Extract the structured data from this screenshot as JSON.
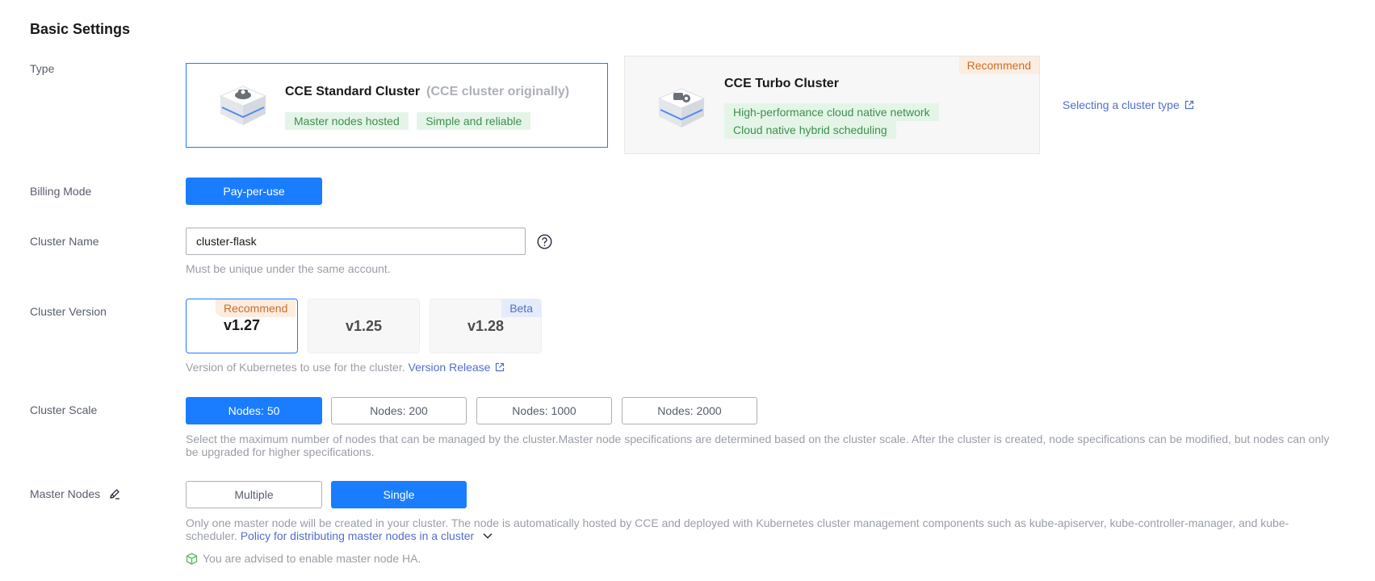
{
  "section_title": "Basic Settings",
  "type": {
    "label": "Type",
    "standard": {
      "name": "CCE Standard Cluster",
      "subtitle": "(CCE cluster originally)",
      "tags": [
        "Master nodes hosted",
        "Simple and reliable"
      ],
      "icon": "server-cube-icon"
    },
    "turbo": {
      "name": "CCE Turbo Cluster",
      "badge": "Recommend",
      "tags": [
        "High-performance cloud native network",
        "Cloud native hybrid scheduling"
      ],
      "icon": "server-cube-icon"
    },
    "help_link": "Selecting a cluster type"
  },
  "billing": {
    "label": "Billing Mode",
    "option": "Pay-per-use"
  },
  "cluster_name": {
    "label": "Cluster Name",
    "value": "cluster-flask",
    "tip": "Must be unique under the same account."
  },
  "version": {
    "label": "Cluster Version",
    "options": [
      {
        "value": "v1.27",
        "badge": "Recommend",
        "selected": true
      },
      {
        "value": "v1.25",
        "badge": "",
        "selected": false
      },
      {
        "value": "v1.28",
        "badge": "Beta",
        "selected": false
      }
    ],
    "tip": "Version of Kubernetes to use for the cluster.",
    "tip_link": "Version Release"
  },
  "scale": {
    "label": "Cluster Scale",
    "options": [
      "Nodes: 50",
      "Nodes: 200",
      "Nodes: 1000",
      "Nodes: 2000"
    ],
    "selected": "Nodes: 50",
    "tip_line1": "Select the maximum number of nodes that can be managed by the cluster.Master node specifications are determined based on the cluster scale. After the cluster is created, node specifications can be modified, but nodes can only",
    "tip_line2": "be upgraded for higher specifications."
  },
  "master": {
    "label": "Master Nodes",
    "options": [
      "Multiple",
      "Single"
    ],
    "selected": "Single",
    "tip_line1": "Only one master node will be created in your cluster. The node is automatically hosted by CCE and deployed with Kubernetes cluster management components such as kube-apiserver, kube-controller-manager, and kube-",
    "tip_line2": "scheduler.",
    "policy_link": "Policy for distributing master nodes in a cluster",
    "advice": "You are advised to enable master node HA."
  },
  "colors": {
    "primary": "#1a7dff",
    "link": "#526ecc",
    "tag_green_bg": "#e4f5e7",
    "tag_green_text": "#3f8f4f",
    "recommend_bg": "#fdece0",
    "recommend_text": "#c96f2b"
  }
}
